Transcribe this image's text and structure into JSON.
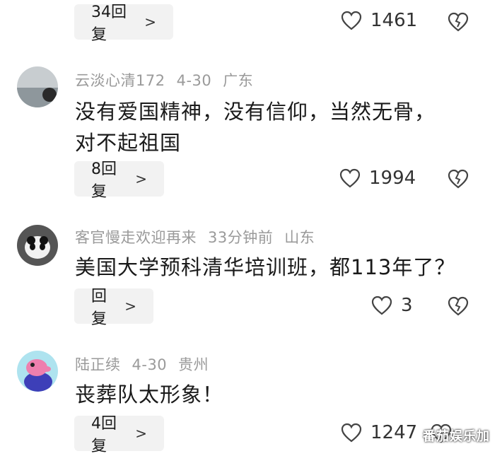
{
  "comments": [
    {
      "reply_label": "34回复",
      "likes": "1461"
    },
    {
      "user": "云淡心清172",
      "date": "4-30",
      "location": "广东",
      "text_line1": "没有爱国精神，没有信仰，当然无骨，",
      "text_line2": "对不起祖国",
      "reply_label": "8回复",
      "likes": "1994"
    },
    {
      "user": "客官慢走欢迎再来",
      "date": "33分钟前",
      "location": "山东",
      "text_line1": "美国大学预科清华培训班，都113年了？",
      "reply_label": "回复",
      "likes": "3"
    },
    {
      "user": "陆正续",
      "date": "4-30",
      "location": "贵州",
      "text_line1": "丧葬队太形象！",
      "reply_label": "4回复",
      "likes": "1247"
    }
  ],
  "icons": {
    "like": "heart-icon",
    "dislike": "broken-heart-icon",
    "chevron": "chevron-right-icon"
  },
  "watermark": "番茄娱乐加"
}
